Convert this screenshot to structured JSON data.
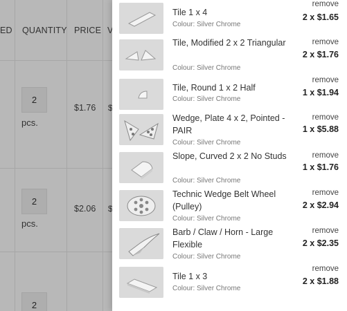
{
  "background": {
    "columns": {
      "ordered_fragment": "ED",
      "quantity": "QUANTITY",
      "price": "PRICE",
      "next_fragment": "V"
    },
    "rows": [
      {
        "qty": "2",
        "unit": "pcs.",
        "price": "$1.76",
        "frag": "$"
      },
      {
        "qty": "2",
        "unit": "pcs.",
        "price": "$2.06",
        "frag": "$"
      },
      {
        "qty": "2",
        "unit": "",
        "price": "",
        "frag": ""
      }
    ]
  },
  "cart": {
    "remove_label": "remove",
    "items": [
      {
        "name": "Tile 1 x 4",
        "colour": "Colour: Silver Chrome",
        "qty_price": "2 x $1.65",
        "icon": "tile-1x4"
      },
      {
        "name": "Tile, Modified 2 x 2 Triangular",
        "colour": "Colour: Silver Chrome",
        "qty_price": "2 x $1.76",
        "icon": "tile-triangular"
      },
      {
        "name": "Tile, Round 1 x 2 Half",
        "colour": "Colour: Silver Chrome",
        "qty_price": "1 x $1.94",
        "icon": "tile-round-half"
      },
      {
        "name": "Wedge, Plate 4 x 2, Pointed - PAIR",
        "colour": "Colour: Silver Chrome",
        "qty_price": "1 x $5.88",
        "icon": "wedge-plate-pair"
      },
      {
        "name": "Slope, Curved 2 x 2 No Studs",
        "colour": "Colour: Silver Chrome",
        "qty_price": "1 x $1.76",
        "icon": "slope-curved"
      },
      {
        "name": "Technic Wedge Belt Wheel (Pulley)",
        "colour": "Colour: Silver Chrome",
        "qty_price": "2 x $2.94",
        "icon": "belt-wheel"
      },
      {
        "name": "Barb / Claw / Horn - Large Flexible",
        "colour": "Colour: Silver Chrome",
        "qty_price": "2 x $2.35",
        "icon": "barb-claw-horn"
      },
      {
        "name": "Tile 1 x 3",
        "colour": "Colour: Silver Chrome",
        "qty_price": "2 x $1.88",
        "icon": "tile-1x3"
      }
    ]
  }
}
